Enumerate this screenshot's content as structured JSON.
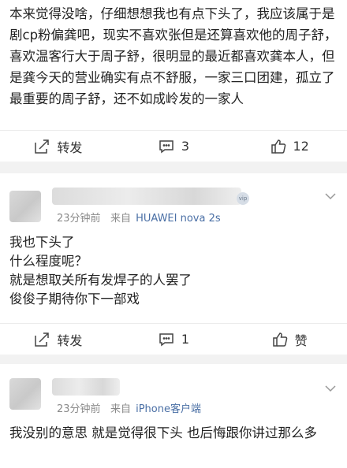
{
  "card1": {
    "text": "本来觉得没啥，仔细想想我也有点下头了，我应该属于是剧cp粉偏龚吧，现实不喜欢张但是还算喜欢他的周子舒，喜欢温客行大于周子舒，很明显的最近都喜欢龚本人，但是龚今天的营业确实有点不舒服，一家三口团建，孤立了最重要的周子舒，还不如成岭发的一家人",
    "repost_label": "转发",
    "comment_count": "3",
    "like_count": "12"
  },
  "card2": {
    "time": "23分钟前",
    "from": "来自",
    "source": "HUAWEI nova 2s",
    "lines": [
      "我也下头了",
      "什么程度呢？",
      "就是想取关所有发焊子的人罢了",
      "俊俊子期待你下一部戏"
    ],
    "repost_label": "转发",
    "comment_count": "1",
    "like_label": "赞"
  },
  "card3": {
    "time": "23分钟前",
    "from": "来自",
    "source": "iPhone客户端",
    "text": "我没别的意思 就是觉得很下头 也后悔跟你讲过那么多"
  },
  "icons": {
    "repost": "repost-icon",
    "comment": "comment-icon",
    "like": "like-icon",
    "menu": "chevron-down-icon"
  }
}
